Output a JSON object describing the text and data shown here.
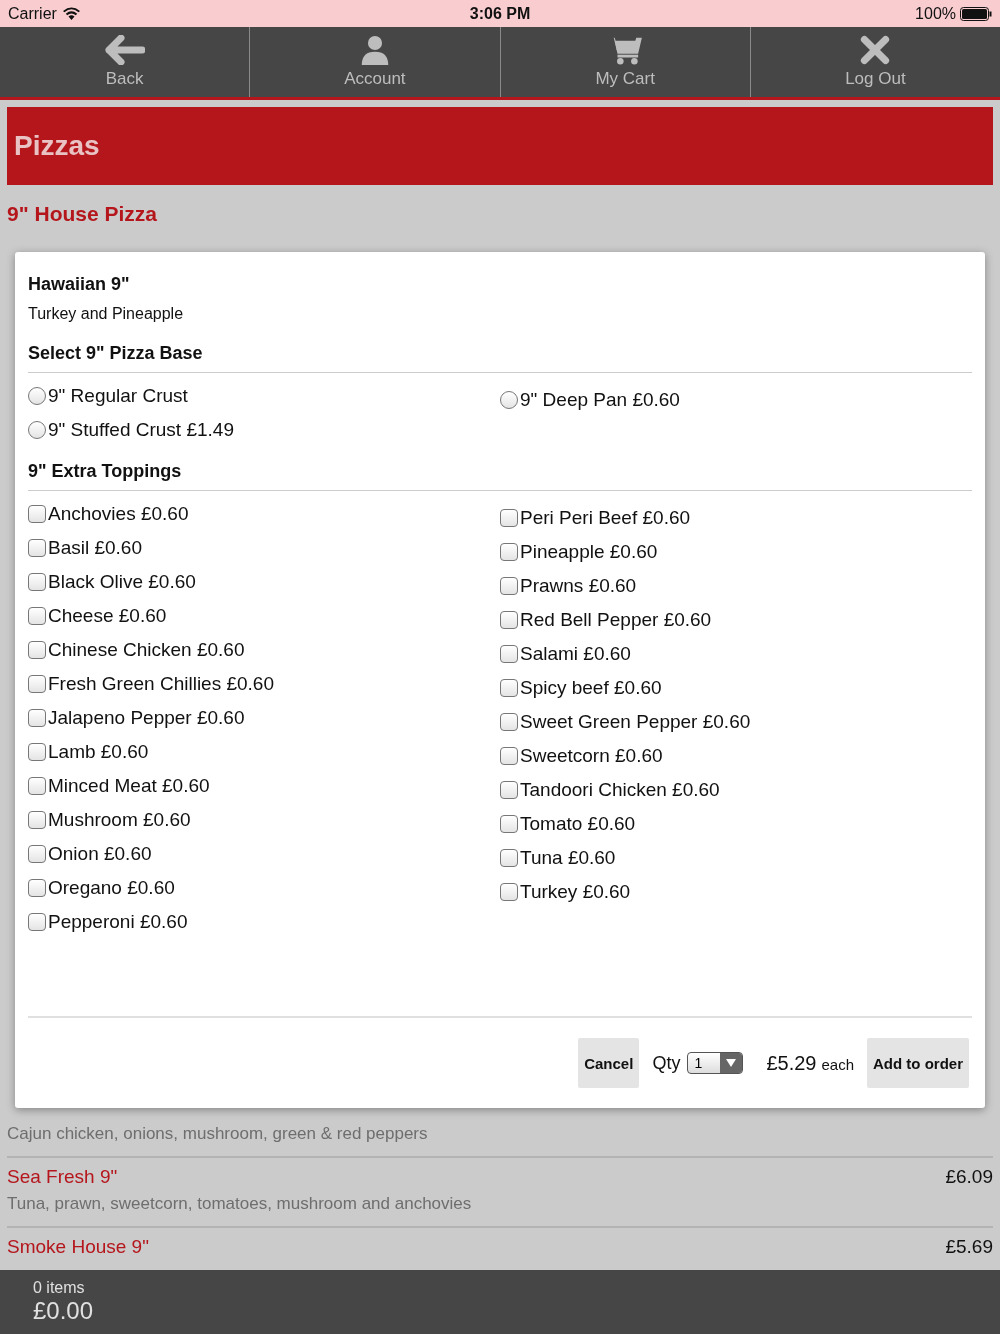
{
  "status_bar": {
    "carrier": "Carrier",
    "time": "3:06 PM",
    "battery": "100%"
  },
  "nav": [
    {
      "kind": "back",
      "label": "Back"
    },
    {
      "kind": "account",
      "label": "Account"
    },
    {
      "kind": "cart",
      "label": "My Cart"
    },
    {
      "kind": "logout",
      "label": "Log Out"
    }
  ],
  "category": {
    "title": "Pizzas",
    "subtitle": "9\" House Pizza"
  },
  "menu_items": [
    {
      "description": "Cajun chicken, onions, mushroom, green & red peppers"
    },
    {
      "name": "Sea Fresh 9\"",
      "price": "£6.09",
      "description": "Tuna, prawn, sweetcorn, tomatoes, mushroom and anchovies"
    },
    {
      "name": "Smoke House 9\"",
      "price": "£5.69"
    }
  ],
  "dialog": {
    "title": "Hawaiian 9\"",
    "subtitle": "Turkey and Pineapple",
    "sections": [
      {
        "kind": "radio",
        "title": "Select 9\" Pizza Base",
        "columns": [
          [
            {
              "label": "9\" Regular Crust",
              "selected": false
            },
            {
              "label": "9\" Stuffed Crust £1.49",
              "selected": false
            }
          ],
          [
            {
              "label": "9\" Deep Pan £0.60",
              "selected": false
            }
          ]
        ]
      },
      {
        "kind": "checkbox",
        "title": "9\" Extra Toppings",
        "columns": [
          [
            {
              "label": "Anchovies £0.60",
              "checked": false
            },
            {
              "label": "Basil £0.60",
              "checked": false
            },
            {
              "label": "Black Olive £0.60",
              "checked": false
            },
            {
              "label": "Cheese £0.60",
              "checked": false
            },
            {
              "label": "Chinese Chicken £0.60",
              "checked": false
            },
            {
              "label": "Fresh Green Chillies £0.60",
              "checked": false
            },
            {
              "label": "Jalapeno Pepper £0.60",
              "checked": false
            },
            {
              "label": "Lamb £0.60",
              "checked": false
            },
            {
              "label": "Minced Meat £0.60",
              "checked": false
            },
            {
              "label": "Mushroom £0.60",
              "checked": false
            },
            {
              "label": "Onion £0.60",
              "checked": false
            },
            {
              "label": "Oregano £0.60",
              "checked": false
            },
            {
              "label": "Pepperoni £0.60",
              "checked": false
            }
          ],
          [
            {
              "label": "Peri Peri Beef £0.60",
              "checked": false
            },
            {
              "label": "Pineapple £0.60",
              "checked": false
            },
            {
              "label": "Prawns £0.60",
              "checked": false
            },
            {
              "label": "Red Bell Pepper £0.60",
              "checked": false
            },
            {
              "label": "Salami £0.60",
              "checked": false
            },
            {
              "label": "Spicy beef £0.60",
              "checked": false
            },
            {
              "label": "Sweet Green Pepper £0.60",
              "checked": false
            },
            {
              "label": "Sweetcorn £0.60",
              "checked": false
            },
            {
              "label": "Tandoori Chicken £0.60",
              "checked": false
            },
            {
              "label": "Tomato £0.60",
              "checked": false
            },
            {
              "label": "Tuna £0.60",
              "checked": false
            },
            {
              "label": "Turkey £0.60",
              "checked": false
            }
          ]
        ]
      }
    ],
    "cancel": "Cancel",
    "qty_label": "Qty",
    "qty": "1",
    "price": "£5.29",
    "price_unit": "each",
    "add": "Add to order"
  },
  "basket": {
    "count": "0 items",
    "total": "£0.00"
  }
}
